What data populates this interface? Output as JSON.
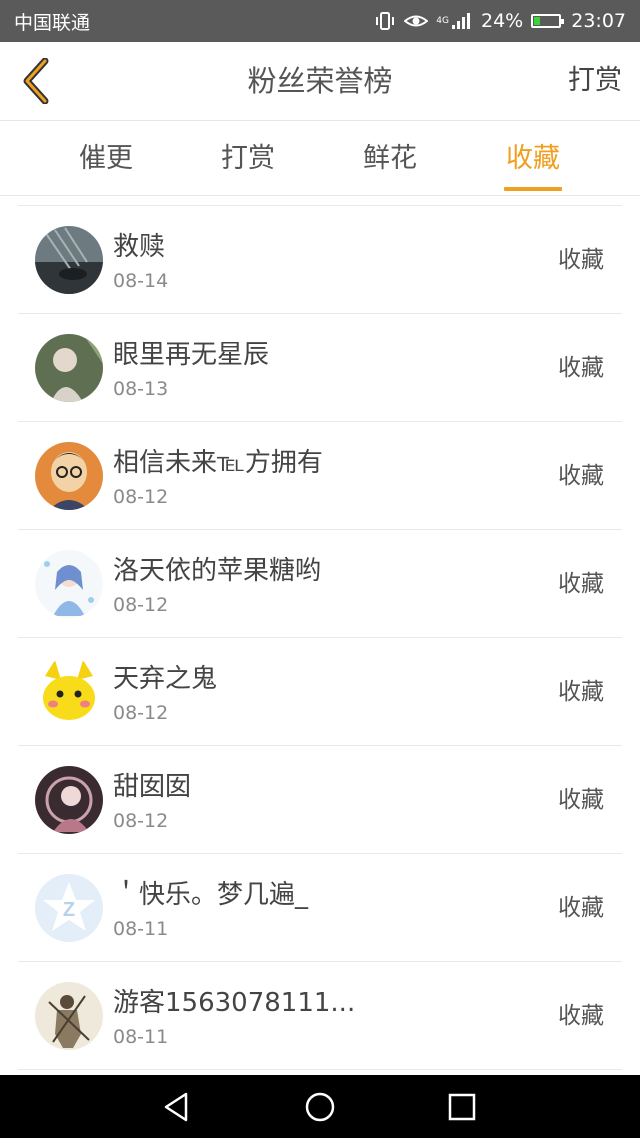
{
  "status_bar": {
    "carrier": "中国联通",
    "network": "4G",
    "battery_percent": "24%",
    "time": "23:07",
    "icons": [
      "vibrate-icon",
      "eye-icon",
      "signal-icon",
      "battery-icon"
    ],
    "battery_level": 0.24
  },
  "header": {
    "title": "粉丝荣誉榜",
    "action_label": "打赏",
    "back_icon": "chevron-left-icon",
    "accent_color": "#f0a020"
  },
  "tabs": [
    {
      "label": "催更",
      "active": false
    },
    {
      "label": "打赏",
      "active": false
    },
    {
      "label": "鲜花",
      "active": false
    },
    {
      "label": "收藏",
      "active": true
    }
  ],
  "list": {
    "items": [
      {
        "name": "救赎",
        "date": "08-14",
        "action": "收藏"
      },
      {
        "name": "眼里再无星辰",
        "date": "08-13",
        "action": "收藏"
      },
      {
        "name": "相信未来℡方拥有",
        "date": "08-12",
        "action": "收藏"
      },
      {
        "name": "洛天依的苹果糖哟",
        "date": "08-12",
        "action": "收藏"
      },
      {
        "name": "天弃之鬼",
        "date": "08-12",
        "action": "收藏"
      },
      {
        "name": "甜囡囡",
        "date": "08-12",
        "action": "收藏"
      },
      {
        "name": "＇快乐。梦几遍_",
        "date": "08-11",
        "action": "收藏"
      },
      {
        "name": "游客1563078111...",
        "date": "08-11",
        "action": "收藏"
      }
    ]
  },
  "nav_bar": {
    "icons": [
      "back-triangle-icon",
      "home-circle-icon",
      "recents-square-icon"
    ]
  }
}
